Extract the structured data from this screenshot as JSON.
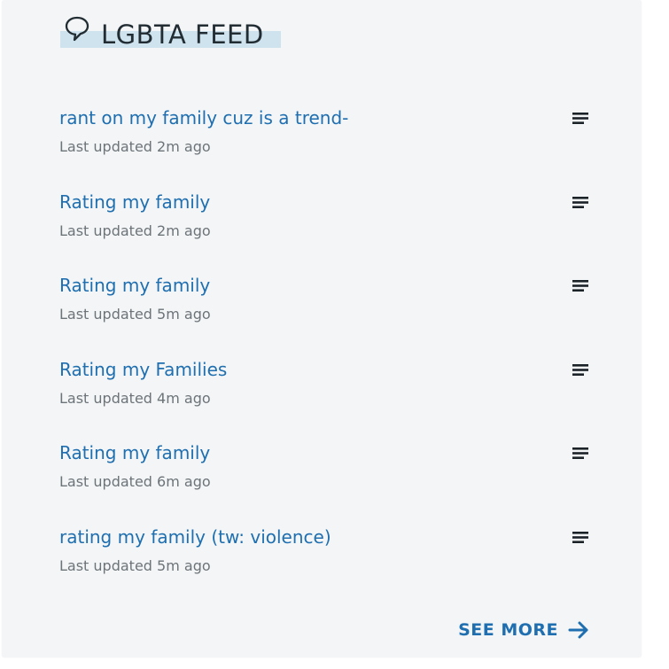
{
  "header": {
    "title": "LGBTA FEED",
    "icon": "speech-bubble-icon"
  },
  "feed": {
    "items": [
      {
        "title": "rant on my family cuz is a trend-",
        "meta": "Last updated 2m ago",
        "icon": "text-lines-icon"
      },
      {
        "title": "Rating my family",
        "meta": "Last updated 2m ago",
        "icon": "text-lines-icon"
      },
      {
        "title": "Rating my family",
        "meta": "Last updated 5m ago",
        "icon": "text-lines-icon"
      },
      {
        "title": "Rating my Families",
        "meta": "Last updated 4m ago",
        "icon": "text-lines-icon"
      },
      {
        "title": "Rating my family",
        "meta": "Last updated 6m ago",
        "icon": "text-lines-icon"
      },
      {
        "title": "rating my family (tw: violence)",
        "meta": "Last updated 5m ago",
        "icon": "text-lines-icon"
      }
    ]
  },
  "footer": {
    "see_more_label": "SEE MORE",
    "icon": "arrow-right-icon"
  },
  "colors": {
    "accent": "#1f6fb0",
    "panel": "#f3f5f6",
    "header_highlight": "#cfe3ee",
    "meta_text": "#6d7479",
    "header_text": "#222c33"
  }
}
